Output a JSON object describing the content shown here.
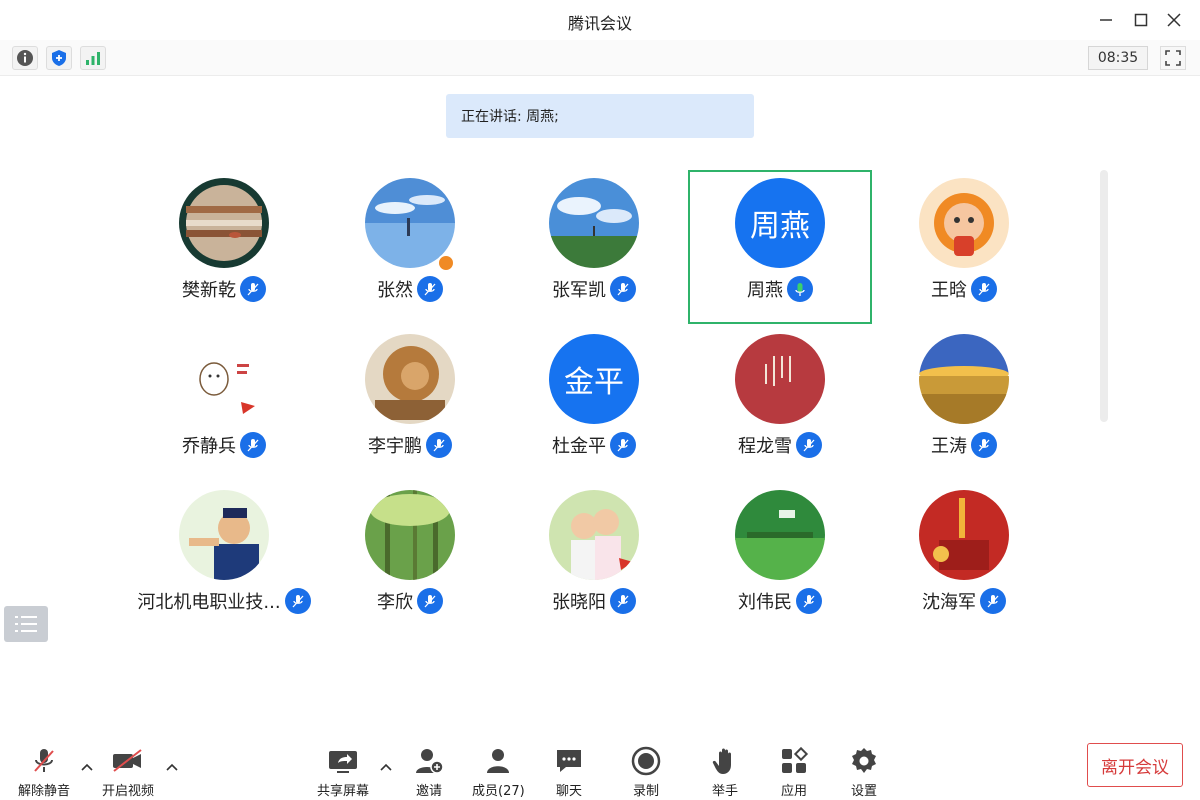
{
  "window": {
    "title": "腾讯会议"
  },
  "status_bar": {
    "timer": "08:35"
  },
  "speaking_banner": {
    "text": "正在讲话: 周燕;"
  },
  "participants": [
    {
      "name": "樊新乾",
      "avatar": "jupiter-photo"
    },
    {
      "name": "张然",
      "avatar": "sky-reflection-photo"
    },
    {
      "name": "张军凯",
      "avatar": "grass-sky-photo"
    },
    {
      "name": "周燕",
      "avatar_text": "周燕",
      "speaking": true
    },
    {
      "name": "王晗",
      "avatar": "lion-cartoon"
    },
    {
      "name": "乔静兵",
      "avatar": "cartoon-sticker"
    },
    {
      "name": "李宇鹏",
      "avatar": "lion-photo"
    },
    {
      "name": "杜金平",
      "avatar_text": "金平"
    },
    {
      "name": "程龙雪",
      "avatar": "red-calligraphy"
    },
    {
      "name": "王涛",
      "avatar": "wheat-field-photo"
    },
    {
      "name": "河北机电职业技...",
      "avatar": "cartoon-man"
    },
    {
      "name": "李欣",
      "avatar": "forest-photo"
    },
    {
      "name": "张晓阳",
      "avatar": "kids-photo"
    },
    {
      "name": "刘伟民",
      "avatar": "green-field-photo"
    },
    {
      "name": "沈海军",
      "avatar": "red-china-photo"
    }
  ],
  "bottom_bar": {
    "unmute": "解除静音",
    "start_video": "开启视频",
    "share_screen": "共享屏幕",
    "invite": "邀请",
    "members": "成员(27)",
    "chat": "聊天",
    "record": "录制",
    "raise_hand": "举手",
    "apps": "应用",
    "settings": "设置",
    "leave": "离开会议"
  },
  "colors": {
    "accent": "#1a6fe8",
    "active_border": "#2fb36a",
    "leave": "#d63b3b"
  }
}
